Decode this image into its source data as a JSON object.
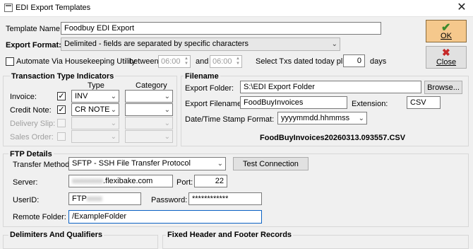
{
  "window": {
    "title": "EDI Export Templates",
    "close_glyph": "✕"
  },
  "template_name": {
    "label": "Template Name:",
    "value": "Foodbuy EDI Export"
  },
  "export_format": {
    "label": "Export Format:",
    "value": "Delimited - fields are separated by specific characters"
  },
  "automate": {
    "label": "Automate Via Housekeeping Utility",
    "between_label": "between",
    "time_from": "06:00",
    "and_label": "and",
    "time_to": "06:00",
    "select_txs_label": "Select Txs dated today plus",
    "days_value": "0",
    "days_label": "days"
  },
  "buttons": {
    "ok": "OK",
    "close": "Close"
  },
  "transaction_types": {
    "title": "Transaction Type Indicators",
    "type_header": "Type",
    "category_header": "Category",
    "rows": [
      {
        "label": "Invoice:",
        "checked": true,
        "enabled": true,
        "type": "INV",
        "category": ""
      },
      {
        "label": "Credit Note:",
        "checked": true,
        "enabled": true,
        "type": "CR NOTE",
        "category": ""
      },
      {
        "label": "Delivery Slip:",
        "checked": false,
        "enabled": false,
        "type": "",
        "category": ""
      },
      {
        "label": "Sales Order:",
        "checked": false,
        "enabled": false,
        "type": "",
        "category": ""
      }
    ]
  },
  "filename": {
    "title": "Filename",
    "export_folder_label": "Export Folder:",
    "export_folder_value": "S:\\EDI Export Folder",
    "browse_label": "Browse...",
    "export_filename_label": "Export Filename:",
    "export_filename_value": "FoodBuyInvoices",
    "extension_label": "Extension:",
    "extension_value": "CSV",
    "timestamp_label": "Date/Time Stamp Format:",
    "timestamp_value": "yyyymmdd.hhmmss",
    "preview": "FoodBuyInvoices20260313.093557.CSV"
  },
  "ftp": {
    "title": "FTP Details",
    "transfer_method_label": "Transfer Method:",
    "transfer_method_value": "SFTP - SSH File Transfer Protocol",
    "test_connection_label": "Test Connection",
    "server_label": "Server:",
    "server_redacted": "xxxxxxxx",
    "server_value": ".flexibake.com",
    "port_label": "Port:",
    "port_value": "22",
    "userid_label": "UserID:",
    "userid_value": "FTP",
    "userid_redacted": "xxxx",
    "password_label": "Password:",
    "password_value": "************",
    "remote_folder_label": "Remote Folder:",
    "remote_folder_value": "/ExampleFolder"
  },
  "sections": {
    "delimiters": "Delimiters And Qualifiers",
    "fixed_header": "Fixed Header and Footer Records"
  },
  "icons": {
    "ok": "checkmark-icon",
    "close": "x-icon",
    "dropdown": "chevron-down-icon"
  },
  "colors": {
    "ok_button": "#f5c88c",
    "focus_border": "#0b62c4",
    "ok_check": "#3d8a2c",
    "close_x": "#c62828"
  }
}
